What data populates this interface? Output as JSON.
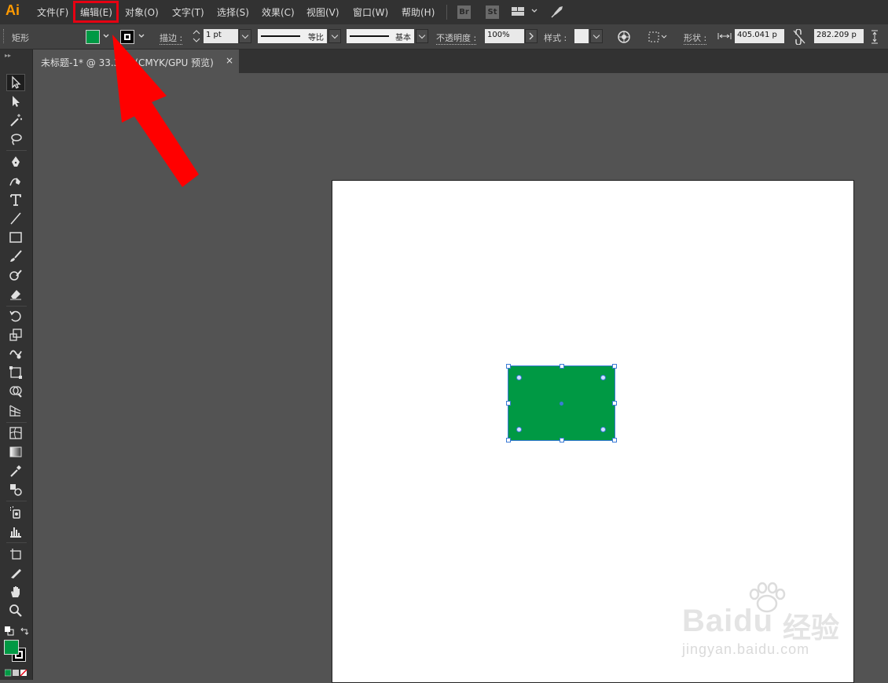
{
  "app": {
    "logo": "Ai"
  },
  "menu": {
    "items": [
      "文件(F)",
      "编辑(E)",
      "对象(O)",
      "文字(T)",
      "选择(S)",
      "效果(C)",
      "视图(V)",
      "窗口(W)",
      "帮助(H)"
    ],
    "highlighted": "编辑(E)"
  },
  "topbar_buttons": {
    "bridge": "Br",
    "stock": "St"
  },
  "control": {
    "object_type": "矩形",
    "stroke_label": "描边 :",
    "stroke_weight": "1 pt",
    "profile_label": "等比",
    "brush_label": "基本",
    "opacity_label": "不透明度 :",
    "opacity_value": "100%",
    "style_label": "样式 :",
    "shape_label": "形状 :",
    "width_value": "405.041 p",
    "height_value": "282.209 p",
    "fill_color": "#009944"
  },
  "document_tab": {
    "title": "未标题-1* @ 33.3 % (CMYK/GPU 预览)",
    "close": "×"
  },
  "watermark": {
    "brand": "Bai",
    "brand_tail": "du",
    "cn": "经验",
    "url": "jingyan.baidu.com"
  },
  "colors": {
    "annotation": "#ff0000",
    "selection": "#3b7bd6",
    "fill": "#009944"
  },
  "tools": [
    "selection-tool-icon",
    "direct-selection-tool-icon",
    "magic-wand-icon",
    "lasso-icon",
    "pen-tool-icon",
    "curvature-tool-icon",
    "type-tool-icon",
    "line-tool-icon",
    "rectangle-tool-icon",
    "paintbrush-icon",
    "shaper-tool-icon",
    "eraser-icon",
    "rotate-tool-icon",
    "scale-tool-icon",
    "warp-tool-icon",
    "free-transform-icon",
    "shape-builder-icon",
    "perspective-grid-icon",
    "mesh-tool-icon",
    "gradient-tool-icon",
    "eyedropper-icon",
    "blend-tool-icon",
    "symbol-sprayer-icon",
    "column-graph-icon",
    "artboard-tool-icon",
    "slice-tool-icon",
    "hand-tool-icon",
    "zoom-tool-icon"
  ]
}
